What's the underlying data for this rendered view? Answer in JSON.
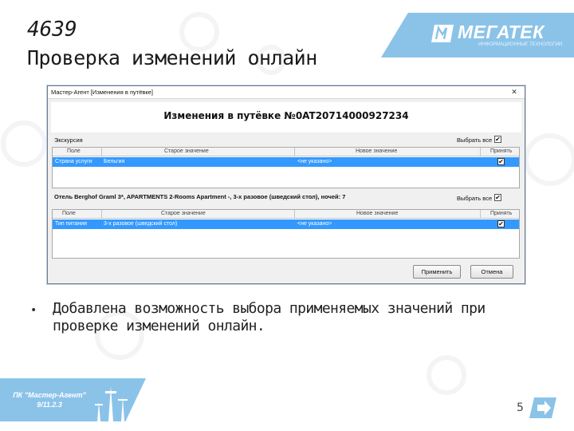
{
  "slide": {
    "number": "4639",
    "title": "Проверка изменений онлайн",
    "bullet": "Добавлена возможность выбора применяемых значений при проверке изменений онлайн.",
    "page_number": "5"
  },
  "brand": {
    "name": "МЕГАТЕК",
    "tagline": "ИНФОРМАЦИОННЫЕ ТЕХНОЛОГИИ"
  },
  "footer": {
    "line1": "ПК \"Мастер-Агент\"",
    "line2": "9/11.2.3"
  },
  "window": {
    "title": "Мастер-Агент [Изменения в путёвке]",
    "close": "✕",
    "heading": "Изменения в путёвке №0AT20714000927234",
    "section1": {
      "label": "Экскурсия",
      "select_all": "Выбрать все",
      "columns": [
        "Поле",
        "Старое значение",
        "Новое значение",
        "Принять"
      ],
      "rows": [
        {
          "field": "Страна услуги",
          "old": "Бельгия",
          "new": "<не указано>",
          "accept": "✔"
        }
      ]
    },
    "section2": {
      "label": "Отель Berghof Graml 3*, APARTMENTS 2-Rooms Apartment -, 3-х разовое (шведский стол), ночей: 7",
      "select_all": "Выбрать все",
      "columns": [
        "Поле",
        "Старое значение",
        "Новое значение",
        "Принять"
      ],
      "rows": [
        {
          "field": "Тип питания",
          "old": "3-х разовое (шведский стол)",
          "new": "<не указано>",
          "accept": "✔"
        }
      ]
    },
    "buttons": {
      "apply": "Применить",
      "cancel": "Отмена"
    },
    "check_mark": "✔"
  },
  "colors": {
    "brand_blue": "#8bc3e8",
    "selection_blue": "#3399ff"
  }
}
